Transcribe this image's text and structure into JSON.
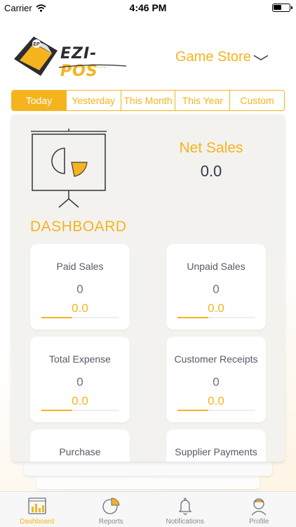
{
  "status_bar": {
    "carrier": "Carrier",
    "time": "4:46 PM"
  },
  "header": {
    "logo_text_1": "EZI-",
    "logo_text_2": "POS",
    "logo_badge": "EP",
    "store_name": "Game Store",
    "store_icon": "chevron-down-icon"
  },
  "tabs": [
    {
      "label": "Today",
      "active": true
    },
    {
      "label": "Yesterday",
      "active": false
    },
    {
      "label": "This Month",
      "active": false
    },
    {
      "label": "This Year",
      "active": false
    },
    {
      "label": "Custom",
      "active": false
    }
  ],
  "dashboard": {
    "title": "DASHBOARD",
    "icon": "presentation-chart-icon",
    "net_sales": {
      "label": "Net Sales",
      "value": "0.0"
    }
  },
  "cards": [
    {
      "title": "Paid Sales",
      "count": "0",
      "amount": "0.0",
      "progress": 0.4
    },
    {
      "title": "Unpaid Sales",
      "count": "0",
      "amount": "0.0",
      "progress": 0.4
    },
    {
      "title": "Total Expense",
      "count": "0",
      "amount": "0.0",
      "progress": 0.4
    },
    {
      "title": "Customer Receipts",
      "count": "0",
      "amount": "0.0",
      "progress": 0.4
    },
    {
      "title": "Purchase",
      "count": "",
      "amount": "",
      "progress": 0
    },
    {
      "title": "Supplier Payments",
      "count": "",
      "amount": "",
      "progress": 0
    }
  ],
  "bottom_nav": [
    {
      "label": "Dashboard",
      "icon": "dashboard-chart-icon",
      "active": true
    },
    {
      "label": "Reports",
      "icon": "pie-chart-icon",
      "active": false
    },
    {
      "label": "Notifications",
      "icon": "bell-icon",
      "active": false
    },
    {
      "label": "Profile",
      "icon": "user-icon",
      "active": false
    }
  ],
  "colors": {
    "accent": "#f5b41e",
    "panel": "#f3f2ef",
    "text_dark": "#333a45"
  }
}
